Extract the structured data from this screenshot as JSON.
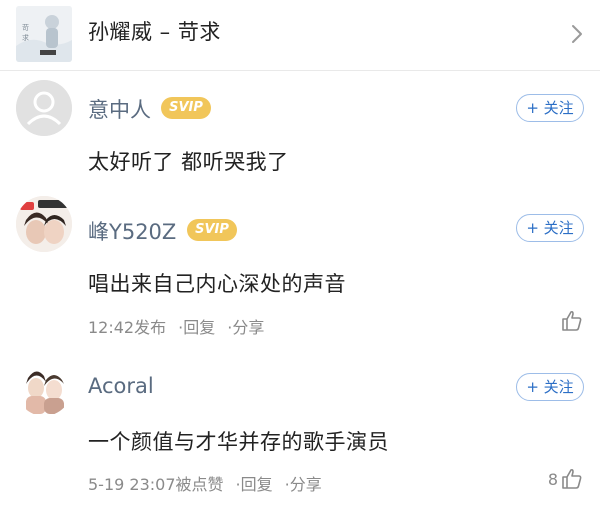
{
  "song": {
    "title": "孙耀威 – 苛求",
    "cover_icon": "album-cover",
    "nav_icon": "chevron-right-icon"
  },
  "comments": [
    {
      "username": "意中人",
      "badge": "SVIP",
      "follow_label": "+ 关注",
      "text": "太好听了  都听哭我了"
    },
    {
      "username": "峰Y520Z",
      "badge": "SVIP",
      "follow_label": "+ 关注",
      "text": "唱出来自己内心深处的声音",
      "time": "12:42发布",
      "reply_label": "回复",
      "share_label": "分享",
      "separator": "·",
      "like_count": ""
    },
    {
      "username": "Acoral",
      "follow_label": "+ 关注",
      "text": "一个颜值与才华并存的歌手演员",
      "time": "5-19 23:07被点赞",
      "reply_label": "回复",
      "share_label": "分享",
      "separator": "·",
      "like_count": "8"
    }
  ],
  "colors": {
    "username": "#5a6b80",
    "svip_badge": "#f1c65a",
    "follow_text": "#2c6fc6",
    "meta_text": "#8a8a8a"
  }
}
